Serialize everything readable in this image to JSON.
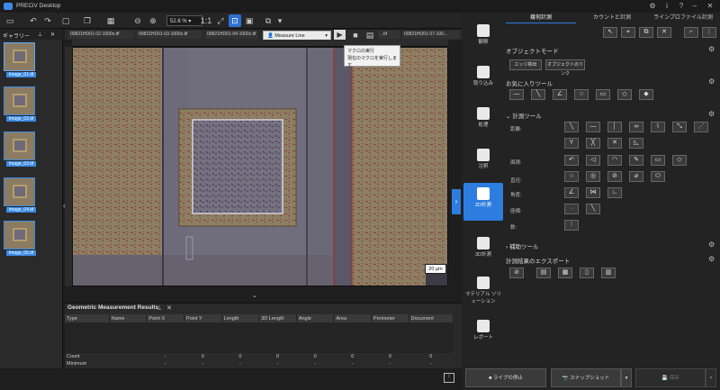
{
  "app": {
    "title": "PRECiV Desktop"
  },
  "toolbar": {
    "zoom_value": "52.6 %"
  },
  "gallery": {
    "title": "ギャラリー",
    "items": [
      {
        "label": "Image_01.tif"
      },
      {
        "label": "Image_02.tif"
      },
      {
        "label": "Image_03.tif"
      },
      {
        "label": "Image_04.tif"
      },
      {
        "label": "Image_05.tif"
      }
    ]
  },
  "doc_tabs": [
    {
      "label": "00821HD01-02-1000x.tif"
    },
    {
      "label": "00821HD01-03-1000x.tif"
    },
    {
      "label": "00821HD01-04-1000x.tif"
    },
    {
      "label": "...tif"
    },
    {
      "label": "00821HD01-07-100..."
    }
  ],
  "macro": {
    "selected": "Measure Line",
    "tooltip_title": "マクロの実行",
    "tooltip_body": "現在のマクロを実行します"
  },
  "viewer": {
    "scale_label": "20 µm"
  },
  "results": {
    "title": "Geometric Measurement Results",
    "columns": [
      "Type",
      "Name",
      "Point X",
      "Point Y",
      "Length",
      "3D Length",
      "Angle",
      "Area",
      "Perimeter",
      "Document"
    ],
    "rows": [
      {
        "label": "Count",
        "values": [
          "-",
          "0",
          "0",
          "0",
          "0",
          "0",
          "0",
          "0"
        ]
      },
      {
        "label": "Minimum",
        "values": [
          "-",
          "-",
          "-",
          "-",
          "-",
          "-",
          "-",
          "-"
        ]
      }
    ]
  },
  "modes": [
    {
      "label": "観察"
    },
    {
      "label": "取り込み"
    },
    {
      "label": "処理"
    },
    {
      "label": "注釈"
    },
    {
      "label": "2D計測"
    },
    {
      "label": "3D計測"
    },
    {
      "label": "マテリアル ソリューション"
    },
    {
      "label": "レポート"
    }
  ],
  "right_tabs": [
    {
      "label": "幾何計測"
    },
    {
      "label": "カウントと計測"
    },
    {
      "label": "ラインプロファイル計測"
    }
  ],
  "right": {
    "object_mode_title": "オブジェクトモード",
    "edge_detect": "エッジ検出",
    "object_link": "オブジェクトのリンク",
    "favorites_title": "お気に入りツール",
    "measure_tools_title": "計測ツール",
    "rows": [
      {
        "label": "距離:"
      },
      {
        "label": "面積:"
      },
      {
        "label": "直径:"
      },
      {
        "label": "角度:"
      },
      {
        "label": "座標:"
      },
      {
        "label": "数:"
      }
    ],
    "aux_tools_title": "補助ツール",
    "export_title": "計測結果のエクスポート"
  },
  "bottom": {
    "live_stop": "ライブの停止",
    "snapshot": "スナップショット",
    "save": "保存"
  }
}
